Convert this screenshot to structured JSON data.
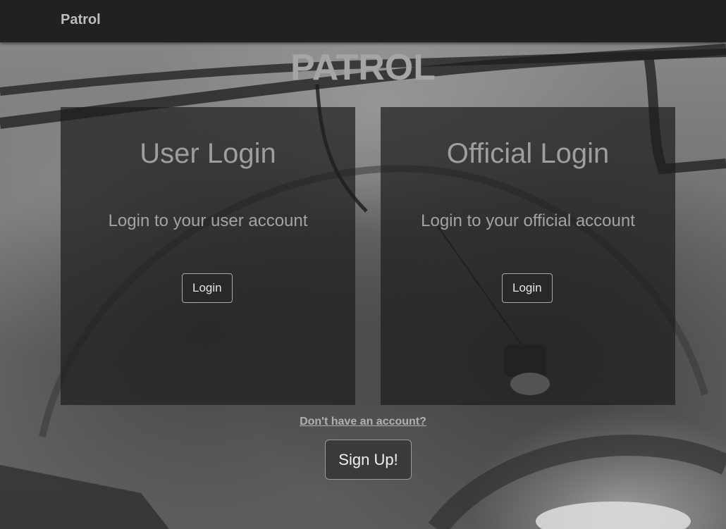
{
  "navbar": {
    "brand": "Patrol"
  },
  "hero": {
    "title": "PATROL"
  },
  "user_card": {
    "title": "User Login",
    "subtitle": "Login to your user account",
    "button_label": "Login"
  },
  "official_card": {
    "title": "Official Login",
    "subtitle": "Login to your official account",
    "button_label": "Login"
  },
  "signup": {
    "prompt_link": "Don't have an account?",
    "button_label": "Sign Up!"
  }
}
